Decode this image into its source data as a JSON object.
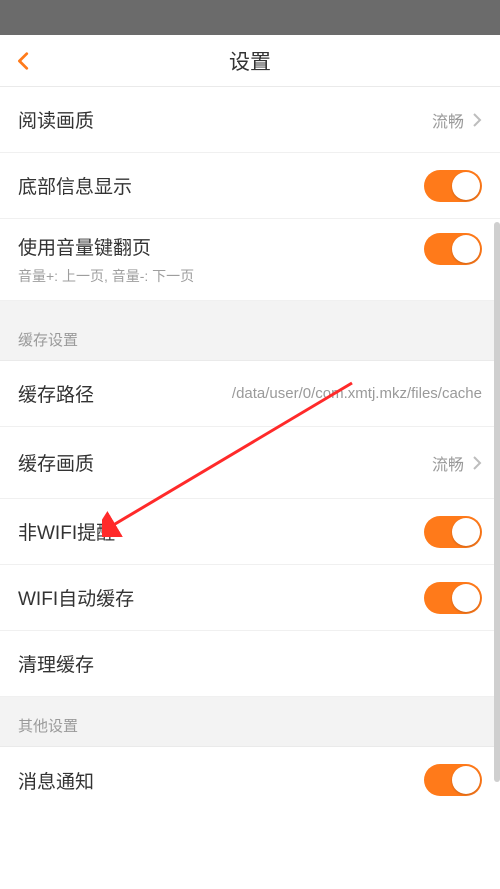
{
  "header": {
    "title": "设置"
  },
  "rows": {
    "reading_quality": {
      "label": "阅读画质",
      "value": "流畅"
    },
    "bottom_info": {
      "label": "底部信息显示"
    },
    "volume_flip": {
      "label": "使用音量键翻页",
      "sub": "音量+: 上一页, 音量-: 下一页"
    }
  },
  "sections": {
    "cache": "缓存设置",
    "other": "其他设置"
  },
  "cache": {
    "path": {
      "label": "缓存路径",
      "value": "/data/user/0/com.xmtj.mkz/files/cache"
    },
    "quality": {
      "label": "缓存画质",
      "value": "流畅"
    },
    "non_wifi": {
      "label": "非WIFI提醒"
    },
    "wifi_auto": {
      "label": "WIFI自动缓存"
    },
    "clear": {
      "label": "清理缓存"
    }
  },
  "other": {
    "notifications": {
      "label": "消息通知"
    }
  },
  "colors": {
    "accent": "#ff7a1a",
    "arrow": "#ff2a2a"
  }
}
